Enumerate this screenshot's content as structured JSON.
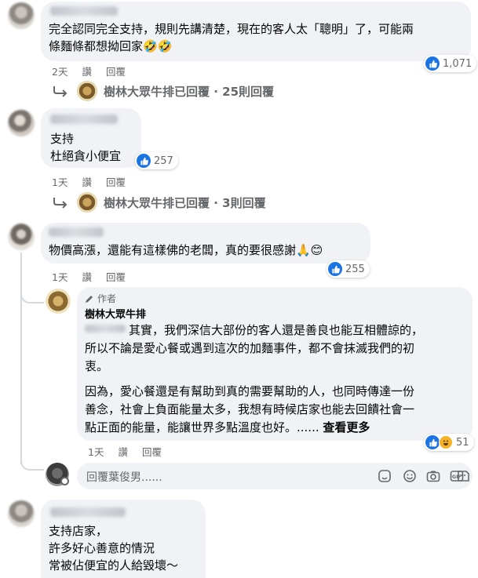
{
  "colors": {
    "link_blue": "#1b74e4",
    "meta_gray": "#65676b",
    "bubble_bg": "#f0f2f5",
    "haha_yellow": "#f7b125"
  },
  "comments": [
    {
      "id": "c1",
      "author_visible": "Ri-hong Tsai",
      "lines": [
        "完全認同完全支持，規則先講清楚，現在的客人太「聰明」了，可能兩",
        "條麵條都想拗回家🤣🤣"
      ],
      "time": "2天",
      "action1": "讚",
      "action2": "回覆",
      "reactions": {
        "count": "1,071",
        "icons": [
          "like-icon",
          "haha-icon"
        ]
      },
      "replies": {
        "avatar": "brand-avatar",
        "text": "樹林大眾牛排已回覆 · 25則回覆"
      }
    },
    {
      "id": "c2",
      "author_visible": "Ri-hong Tsai",
      "lines": [
        "支持",
        "杜絕貪小便宜"
      ],
      "time": "1天",
      "action1": "讚",
      "action2": "回覆",
      "reactions": {
        "count": "257",
        "icons": [
          "like-icon"
        ]
      },
      "replies": {
        "avatar": "brand-avatar",
        "text": "樹林大眾牛排已回覆 · 3則回覆"
      }
    },
    {
      "id": "c3",
      "author_visible": "Ri-hong Tsai",
      "lines": [
        "物價高漲，還能有這樣佛的老闆，真的要很感謝🙏😊"
      ],
      "time": "1天",
      "action1": "讚",
      "action2": "回覆",
      "reactions": {
        "count": "255",
        "icons": [
          "like-icon"
        ]
      },
      "author_reply": {
        "tag": "作者",
        "name": "樹林大眾牛排",
        "mention_blur": "Vera Lin",
        "lines": [
          "其實，我們深信大部份的客人還是善良也能互相體諒的，",
          "所以不論是愛心餐或遇到這次的加麵事件，都不會抹滅我們的初",
          "衷。"
        ],
        "lines2": [
          "因為，愛心餐還是有幫助到真的需要幫助的人，也同時傳達一份",
          "善念，社會上負面能量太多，我想有時候店家也能去回饋社會一",
          "點正面的能量，能讓世界多點溫度也好。......"
        ],
        "see_more": "查看更多",
        "time": "1天",
        "action1": "讚",
        "action2": "回覆",
        "reactions": {
          "count": "51",
          "icons": [
            "like-icon",
            "haha-icon"
          ]
        }
      },
      "reply_input": {
        "placeholder": "回覆葉俊男......"
      }
    },
    {
      "id": "c4",
      "author_visible": "Ri-hong Tsai",
      "lines": [
        "支持店家，",
        "許多好心善意的情況",
        "常被佔便宜的人給毀壞～"
      ]
    }
  ],
  "input_icons": [
    "sticker-icon",
    "emoji-icon",
    "camera-icon",
    "gif-icon",
    "sticker-face-icon"
  ]
}
